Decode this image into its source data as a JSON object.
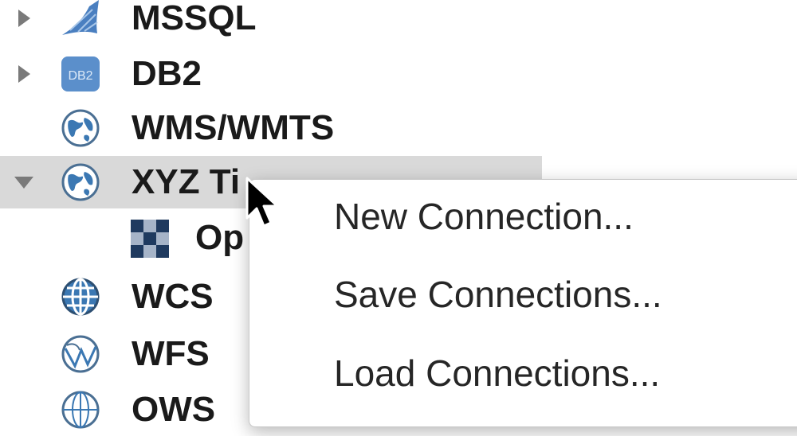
{
  "browser_tree": {
    "items": [
      {
        "label": "MSSQL",
        "icon": "mssql-icon",
        "expand": "collapsed"
      },
      {
        "label": "DB2",
        "icon": "db2-icon",
        "icon_text": "DB2",
        "expand": "collapsed"
      },
      {
        "label": "WMS/WMTS",
        "icon": "globe-icon",
        "expand": "none"
      },
      {
        "label": "XYZ Ti",
        "icon": "globe-icon",
        "expand": "expanded",
        "selected": true
      },
      {
        "label": "Op",
        "icon": "tile-layer-icon",
        "expand": "none",
        "child": true
      },
      {
        "label": "WCS",
        "icon": "wcs-globe-icon",
        "expand": "none"
      },
      {
        "label": "WFS",
        "icon": "wfs-globe-icon",
        "expand": "none"
      },
      {
        "label": "OWS",
        "icon": "ows-globe-icon",
        "expand": "none"
      }
    ]
  },
  "context_menu": {
    "items": [
      {
        "label": "New Connection..."
      },
      {
        "label": "Save Connections..."
      },
      {
        "label": "Load Connections..."
      }
    ]
  },
  "colors": {
    "selected_row": "#d9d9d9",
    "globe_blue": "#3b78b3",
    "db2_blue": "#5b8fcb"
  }
}
